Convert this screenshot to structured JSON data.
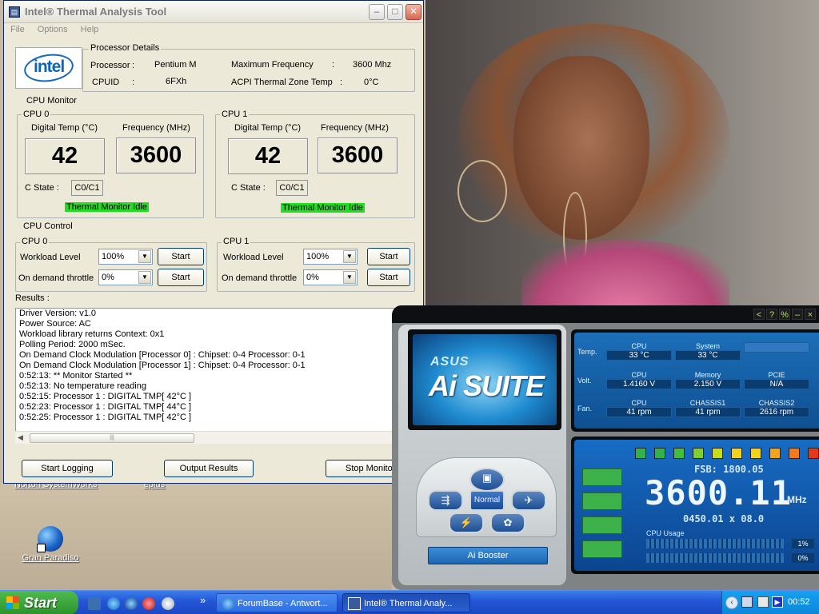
{
  "intel_window": {
    "title": "Intel® Thermal Analysis Tool",
    "menu": [
      "File",
      "Options",
      "Help"
    ],
    "processor_details_label": "Processor Details",
    "logo_text": "intel",
    "processor_label": "Processor",
    "processor_value": "Pentium M",
    "cpuid_label": "CPUID",
    "cpuid_value": "6FXh",
    "max_freq_label": "Maximum Frequency",
    "max_freq_value": "3600 Mhz",
    "acpi_label": "ACPI Thermal Zone Temp",
    "acpi_value": "0°C",
    "colon": ":",
    "cpu_monitor_label": "CPU Monitor",
    "cpu_control_label": "CPU Control",
    "monitors": [
      {
        "name": "CPU 0",
        "temp_label": "Digital Temp (°C)",
        "freq_label": "Frequency (MHz)",
        "temp": "42",
        "freq": "3600",
        "cstate_label": "C State  :",
        "cstate": "C0/C1",
        "status": "Thermal Monitor Idle"
      },
      {
        "name": "CPU 1",
        "temp_label": "Digital Temp (°C)",
        "freq_label": "Frequency (MHz)",
        "temp": "42",
        "freq": "3600",
        "cstate_label": "C State  :",
        "cstate": "C0/C1",
        "status": "Thermal Monitor Idle"
      }
    ],
    "controls": [
      {
        "name": "CPU 0",
        "workload_label": "Workload  Level",
        "workload": "100%",
        "throttle_label": "On demand throttle",
        "throttle": "0%",
        "start": "Start"
      },
      {
        "name": "CPU 1",
        "workload_label": "Workload  Level",
        "workload": "100%",
        "throttle_label": "On demand throttle",
        "throttle": "0%",
        "start": "Start"
      }
    ],
    "results_label": "Results :",
    "results": [
      "Driver Version: v1.0",
      "Power Source: AC",
      "Workload library returns Context: 0x1",
      "Polling Period: 2000 mSec.",
      "On Demand Clock Modulation [Processor 0] : Chipset: 0-4  Processor: 0-1",
      "On Demand Clock Modulation [Processor 1] : Chipset: 0-4  Processor: 0-1",
      "0:52:13:  ** Monitor Started **",
      "0:52:13:  No temperature reading",
      "0:52:15: Processor 1 : DIGITAL TMP[ 42°C ]",
      "0:52:23: Processor 1 : DIGITAL TMP[ 44°C ]",
      "0:52:25: Processor 1 : DIGITAL TMP[ 42°C ]"
    ],
    "buttons": {
      "start_logging": "Start Logging",
      "output_results": "Output Results",
      "stop_monitor": "Stop Monito"
    }
  },
  "desktop_icons": [
    {
      "label": "Norton SystemWorks",
      "icon": "norton-icon"
    },
    {
      "label": "eplus",
      "icon": "eplus-icon"
    },
    {
      "label": "Gran Paradiso",
      "icon": "globe-icon"
    }
  ],
  "ai_suite": {
    "title_buttons": [
      "<",
      "?",
      "%",
      "–",
      "×"
    ],
    "brand": "ASUS",
    "product": "Ai SUITE",
    "row_labels": [
      "Temp.",
      "Volt.",
      "Fan."
    ],
    "temp": [
      {
        "name": "CPU",
        "value": "33 °C"
      },
      {
        "name": "System",
        "value": "33 °C"
      },
      {
        "name": "",
        "value": ""
      }
    ],
    "volt": [
      {
        "name": "CPU",
        "value": "1.4160  V"
      },
      {
        "name": "Memory",
        "value": "2.150  V"
      },
      {
        "name": "PCIE",
        "value": "N/A"
      }
    ],
    "fan": [
      {
        "name": "CPU",
        "value": "41  rpm"
      },
      {
        "name": "CHASSIS1",
        "value": "41  rpm"
      },
      {
        "name": "CHASSIS2",
        "value": "2616  rpm"
      }
    ],
    "mode_label": "Normal",
    "booster_label": "Ai Booster",
    "fsb": "FSB:  1800.05",
    "frequency": "3600.11",
    "unit": "MHz",
    "multiplier": "0450.01   x   08.0",
    "cpu_usage_label": "CPU Usage",
    "usage": [
      "1%",
      "0%"
    ],
    "led_colors": [
      "#2fb34a",
      "#2fb34a",
      "#3fbf3f",
      "#7fcf2f",
      "#c6dd1c",
      "#f2d21a",
      "#f2d21a",
      "#f2a51a",
      "#f27a1a",
      "#e03a1a",
      "#d41a1a"
    ]
  },
  "taskbar": {
    "start_label": "Start",
    "tasks": [
      {
        "label": "ForumBase - Antwort...",
        "active": false
      },
      {
        "label": "Intel® Thermal Analy...",
        "active": true
      }
    ],
    "overflow": "»",
    "clock": "00:52"
  }
}
